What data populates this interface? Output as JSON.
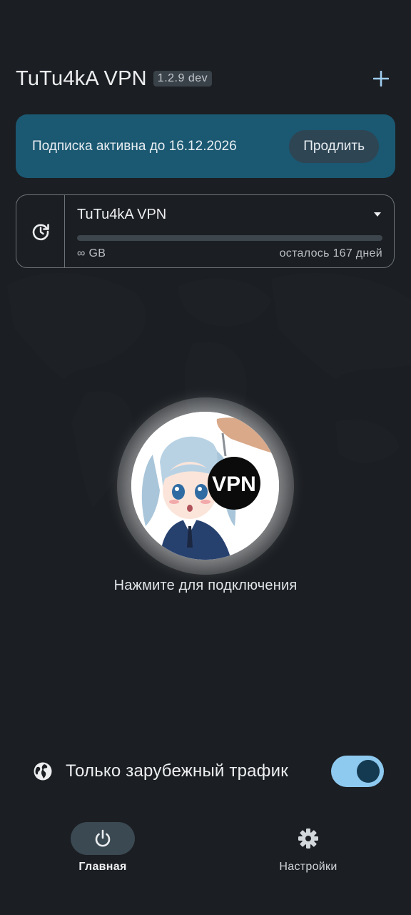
{
  "header": {
    "title": "TuTu4kA VPN",
    "version": "1.2.9 dev",
    "add_icon": "plus-icon"
  },
  "subscription": {
    "text": "Подписка активна до 16.12.2026",
    "renew_label": "Продлить"
  },
  "profile": {
    "name": "TuTu4kA VPN",
    "traffic": "∞ GB",
    "remaining": "осталось 167 дней",
    "usage_fraction": 0.0,
    "refresh_icon": "refresh-clock-icon",
    "dropdown_icon": "caret-down-icon"
  },
  "connect": {
    "badge": "VPN",
    "hint": "Нажмите для подключения"
  },
  "foreign_traffic": {
    "label": "Только зарубежный трафик",
    "enabled": true,
    "icon": "globe-icon"
  },
  "nav": {
    "items": [
      {
        "label": "Главная",
        "icon": "power-icon",
        "active": true
      },
      {
        "label": "Настройки",
        "icon": "gear-icon",
        "active": false
      }
    ]
  },
  "colors": {
    "background": "#1b1e22",
    "banner": "#1b5872",
    "accent": "#8ec9ef"
  }
}
